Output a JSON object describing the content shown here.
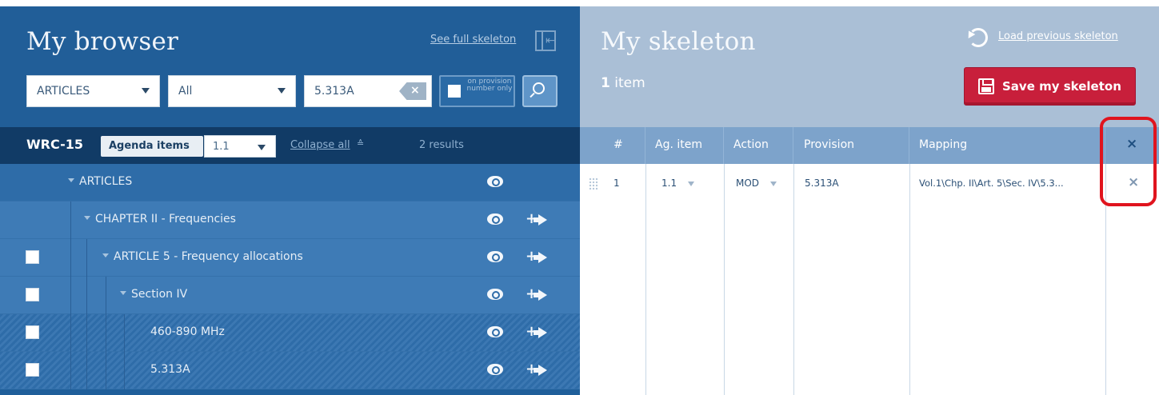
{
  "browser": {
    "title": "My browser",
    "see_full_skeleton": "See full skeleton",
    "filters": {
      "type_select": "ARTICLES",
      "scope_select": "All",
      "search_value": "5.313A",
      "clear_icon": "×",
      "provision_toggle_label": "on provision number only"
    },
    "conference": {
      "label": "WRC-15",
      "agenda_items_label": "Agenda items",
      "agenda_item_value": "1.1",
      "collapse_all": "Collapse all",
      "collapse_icon": "≙",
      "results": "2 results"
    },
    "tree": [
      {
        "label": "ARTICLES",
        "level": 0,
        "checkbox": false,
        "add": false,
        "expanded": true
      },
      {
        "label": "CHAPTER II - Frequencies",
        "level": 1,
        "checkbox": false,
        "add": true,
        "expanded": true
      },
      {
        "label": "ARTICLE 5 - Frequency allocations",
        "level": 2,
        "checkbox": true,
        "add": true,
        "expanded": true
      },
      {
        "label": "Section IV",
        "level": 3,
        "checkbox": true,
        "add": true,
        "expanded": true
      },
      {
        "label": "460-890 MHz",
        "level": 4,
        "checkbox": true,
        "add": true,
        "expanded": false
      },
      {
        "label": "5.313A",
        "level": 4,
        "checkbox": true,
        "add": true,
        "expanded": false
      }
    ]
  },
  "skeleton": {
    "title": "My skeleton",
    "load_previous": "Load previous skeleton",
    "item_count": "1",
    "item_count_suffix": " item",
    "save_button": "Save my skeleton",
    "columns": [
      "#",
      "Ag. item",
      "Action",
      "Provision",
      "Mapping"
    ],
    "remove_all_icon": "×",
    "rows": [
      {
        "num": "1",
        "ag_item": "1.1",
        "action": "MOD",
        "provision": "5.313A",
        "mapping": "Vol.1\\Chp. II\\Art. 5\\Sec. IV\\5.3...",
        "remove_icon": "×"
      }
    ]
  },
  "colors": {
    "left_panel": "#215e98",
    "right_header": "#aabfd6",
    "table_header": "#7da3cb",
    "save_button": "#c81f3b",
    "highlight": "#e0141e"
  }
}
